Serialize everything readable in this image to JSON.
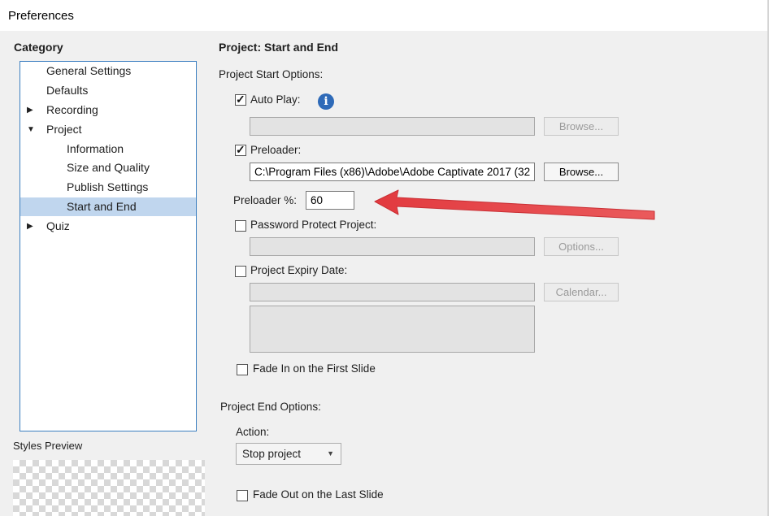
{
  "window": {
    "title": "Preferences"
  },
  "sidebar": {
    "title": "Category",
    "items": [
      {
        "label": "General Settings",
        "level": 0,
        "expander": ""
      },
      {
        "label": "Defaults",
        "level": 0,
        "expander": ""
      },
      {
        "label": "Recording",
        "level": 0,
        "expander": "collapsed"
      },
      {
        "label": "Project",
        "level": 0,
        "expander": "expanded"
      },
      {
        "label": "Information",
        "level": 1,
        "expander": ""
      },
      {
        "label": "Size and Quality",
        "level": 1,
        "expander": ""
      },
      {
        "label": "Publish Settings",
        "level": 1,
        "expander": ""
      },
      {
        "label": "Start and End",
        "level": 1,
        "expander": "",
        "selected": true
      },
      {
        "label": "Quiz",
        "level": 0,
        "expander": "collapsed"
      }
    ],
    "styles_preview_label": "Styles Preview"
  },
  "main": {
    "title": "Project: Start and End",
    "start_options_label": "Project Start Options:",
    "auto_play": {
      "label": "Auto Play:",
      "checked": true,
      "value": "",
      "button": "Browse..."
    },
    "preloader": {
      "label": "Preloader:",
      "checked": true,
      "value": "C:\\Program Files (x86)\\Adobe\\Adobe Captivate 2017 (32",
      "button": "Browse..."
    },
    "preloader_percent": {
      "label": "Preloader %:",
      "value": "60"
    },
    "password": {
      "label": "Password Protect Project:",
      "checked": false,
      "value": "",
      "button": "Options..."
    },
    "expiry": {
      "label": "Project Expiry Date:",
      "checked": false,
      "value": "",
      "button": "Calendar..."
    },
    "fade_in": {
      "label": "Fade In on the First Slide",
      "checked": false
    },
    "end_options_label": "Project End Options:",
    "action": {
      "label": "Action:",
      "value": "Stop project"
    },
    "fade_out": {
      "label": "Fade Out on the Last Slide",
      "checked": false
    }
  },
  "colors": {
    "selection": "#c0d6ee",
    "tree_border": "#3c7fc0",
    "arrow": "#e8464a",
    "info": "#2e6ab8"
  },
  "icons": {
    "info": "info-icon",
    "expand": "triangle-down-icon",
    "collapse": "triangle-right-icon",
    "dropdown": "chevron-down-icon"
  }
}
